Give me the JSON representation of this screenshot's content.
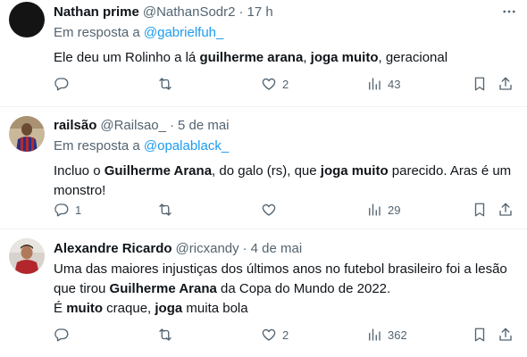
{
  "tweets": [
    {
      "name": "Nathan prime",
      "handle": "@NathanSodr2",
      "separator": "·",
      "time": "17 h",
      "reply_prefix": "Em resposta a ",
      "reply_to": "@gabrielfuh_",
      "text_parts": [
        "Ele deu um Rolinho a lá ",
        "guilherme arana",
        ", ",
        "joga muito",
        ", geracional"
      ],
      "replies": "",
      "retweets": "",
      "likes": "2",
      "views": "43"
    },
    {
      "name": "railsão",
      "handle": "@Railsao_",
      "separator": "·",
      "time": "5 de mai",
      "reply_prefix": "Em resposta a ",
      "reply_to": "@opalablack_",
      "text_parts": [
        "Incluo o ",
        "Guilherme Arana",
        ", do galo (rs), que ",
        "joga muito",
        " parecido. Aras é um monstro!"
      ],
      "replies": "1",
      "retweets": "",
      "likes": "",
      "views": "29"
    },
    {
      "name": "Alexandre Ricardo",
      "handle": "@ricxandy",
      "separator": "·",
      "time": "4 de mai",
      "text_line1": "Uma das maiores injustiças dos últimos anos no futebol brasileiro foi a lesão que tirou ",
      "text_bold1": "Guilherme Arana",
      "text_line1b": " da Copa do Mundo de 2022.",
      "text_line2a": "É ",
      "text_bold2": "muito",
      "text_line2b": " craque, ",
      "text_bold3": "joga",
      "text_line2c": " muita bola",
      "replies": "",
      "retweets": "",
      "likes": "2",
      "views": "362"
    }
  ],
  "colors": {
    "text": "#0f1419",
    "secondary": "#536471",
    "link": "#1d9bf0",
    "divider": "#eff3f4"
  },
  "icons": [
    "more-icon",
    "reply-icon",
    "retweet-icon",
    "like-icon",
    "views-icon",
    "bookmark-icon",
    "share-icon"
  ]
}
